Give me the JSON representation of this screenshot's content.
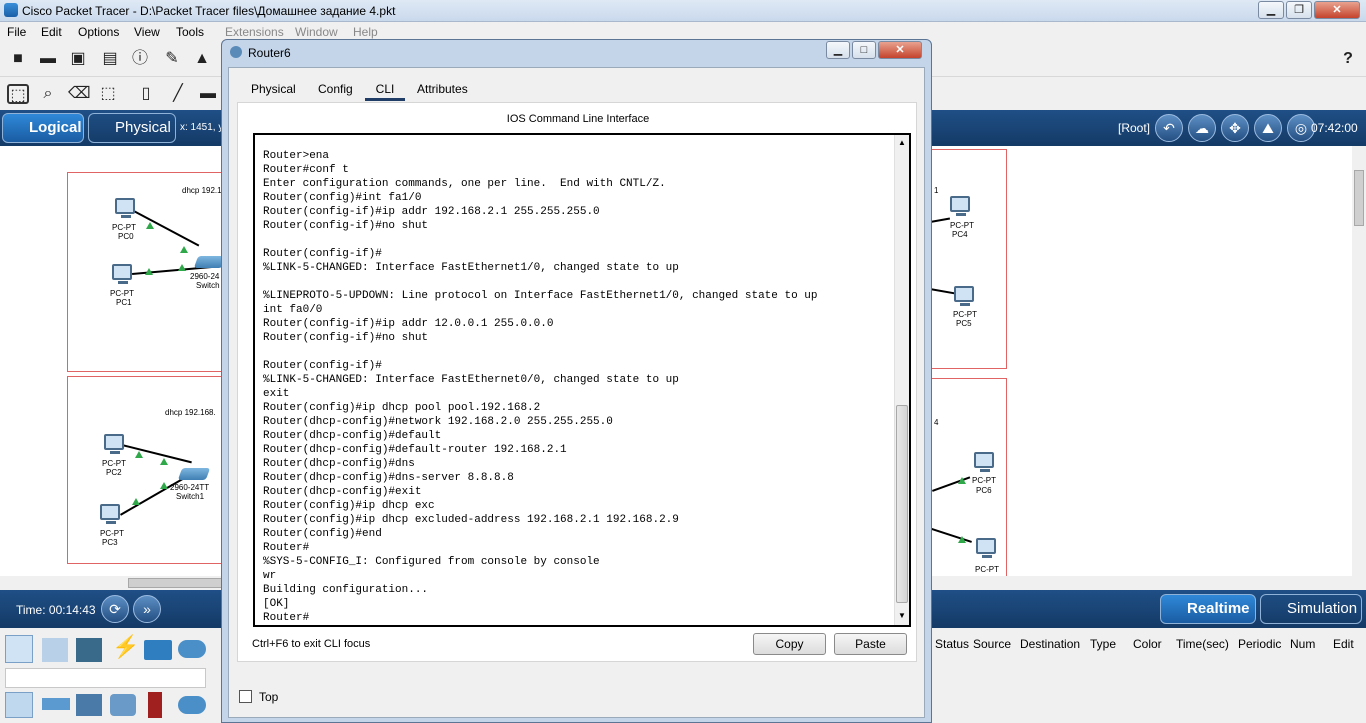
{
  "app": {
    "title": "Cisco Packet Tracer - D:\\Packet Tracer files\\Домашнее задание 4.pkt"
  },
  "menu": {
    "items": [
      "File",
      "Edit",
      "Options",
      "View",
      "Tools",
      "Extensions",
      "Window",
      "Help"
    ]
  },
  "help_icon": "?",
  "modebar": {
    "logical": "Logical",
    "physical": "Physical",
    "coords": "x: 1451, y",
    "root": "[Root]",
    "clock": "07:42:00"
  },
  "workspace": {
    "labels": {
      "dhcp_top": "dhcp 192.168.",
      "dhcp_bottom": "dhcp 192.168.",
      "pc0_type": "PC-PT",
      "pc0": "PC0",
      "pc1_type": "PC-PT",
      "pc1": "PC1",
      "sw0_type": "2960-24",
      "sw0": "Switch",
      "pc2_type": "PC-PT",
      "pc2": "PC2",
      "pc3_type": "PC-PT",
      "pc3": "PC3",
      "sw1_type": "2960-24TT",
      "sw1": "Switch1",
      "pc4_type": "PC-PT",
      "pc4": "PC4",
      "pc5_type": "PC-PT",
      "pc5": "PC5",
      "pc6_type": "PC-PT",
      "pc6": "PC6",
      "pc7_type": "PC-PT",
      "frag1": "1",
      "frag2": "4"
    }
  },
  "timebar": {
    "time": "Time: 00:14:43",
    "realtime": "Realtime",
    "simulation": "Simulation"
  },
  "pdu_headers": [
    "Status",
    "Source",
    "Destination",
    "Type",
    "Color",
    "Time(sec)",
    "Periodic",
    "Num",
    "Edit"
  ],
  "router_window": {
    "title": "Router6",
    "tabs": [
      "Physical",
      "Config",
      "CLI",
      "Attributes"
    ],
    "active_tab": "CLI",
    "cli_title": "IOS Command Line Interface",
    "cli_output": "Router>ena\nRouter#conf t\nEnter configuration commands, one per line.  End with CNTL/Z.\nRouter(config)#int fa1/0\nRouter(config-if)#ip addr 192.168.2.1 255.255.255.0\nRouter(config-if)#no shut\n\nRouter(config-if)#\n%LINK-5-CHANGED: Interface FastEthernet1/0, changed state to up\n\n%LINEPROTO-5-UPDOWN: Line protocol on Interface FastEthernet1/0, changed state to up\nint fa0/0\nRouter(config-if)#ip addr 12.0.0.1 255.0.0.0\nRouter(config-if)#no shut\n\nRouter(config-if)#\n%LINK-5-CHANGED: Interface FastEthernet0/0, changed state to up\nexit\nRouter(config)#ip dhcp pool pool.192.168.2\nRouter(dhcp-config)#network 192.168.2.0 255.255.255.0\nRouter(dhcp-config)#default\nRouter(dhcp-config)#default-router 192.168.2.1\nRouter(dhcp-config)#dns\nRouter(dhcp-config)#dns-server 8.8.8.8\nRouter(dhcp-config)#exit\nRouter(config)#ip dhcp exc\nRouter(config)#ip dhcp excluded-address 192.168.2.1 192.168.2.9\nRouter(config)#end\nRouter#\n%SYS-5-CONFIG_I: Configured from console by console\nwr\nBuilding configuration...\n[OK]\nRouter#",
    "hint": "Ctrl+F6 to exit CLI focus",
    "copy_label": "Copy",
    "paste_label": "Paste",
    "top_label": "Top"
  },
  "colors": {
    "brand_blue": "#1f4f86",
    "link_green": "#2fa84a",
    "region_red": "#e06464"
  }
}
